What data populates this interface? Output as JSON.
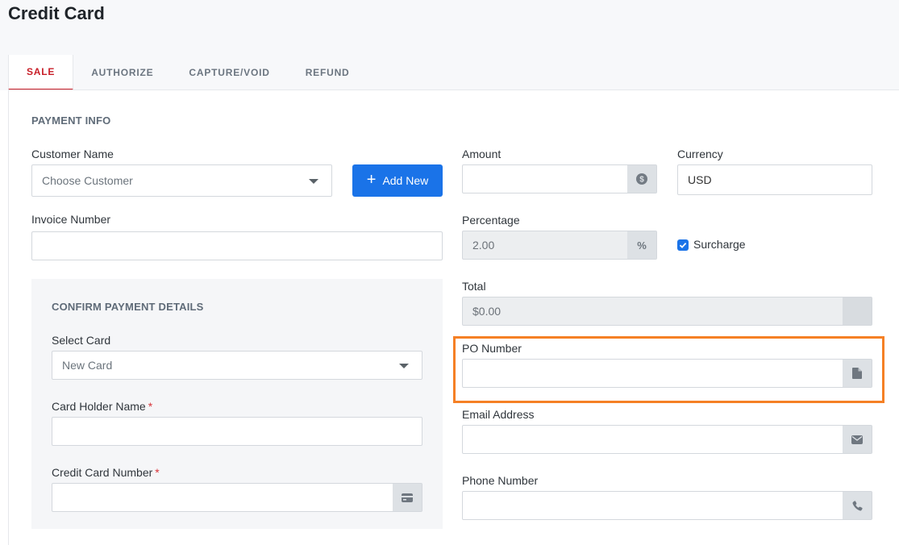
{
  "page": {
    "title": "Credit Card"
  },
  "tabs": [
    {
      "label": "SALE",
      "active": true
    },
    {
      "label": "AUTHORIZE",
      "active": false
    },
    {
      "label": "CAPTURE/VOID",
      "active": false
    },
    {
      "label": "REFUND",
      "active": false
    }
  ],
  "payment_info": {
    "title": "PAYMENT INFO",
    "customer_name": {
      "label": "Customer Name",
      "placeholder": "Choose Customer"
    },
    "add_new_label": "Add New",
    "invoice_number": {
      "label": "Invoice Number",
      "value": ""
    },
    "amount": {
      "label": "Amount",
      "value": "",
      "icon": "dollar-icon"
    },
    "currency": {
      "label": "Currency",
      "value": "USD"
    },
    "percentage": {
      "label": "Percentage",
      "value": "2.00",
      "addon": "%"
    },
    "surcharge": {
      "label": "Surcharge",
      "checked": true
    },
    "total": {
      "label": "Total",
      "value": "$0.00"
    },
    "po_number": {
      "label": "PO Number",
      "value": "",
      "icon": "document-icon"
    },
    "email": {
      "label": "Email Address",
      "value": "",
      "icon": "envelope-icon"
    },
    "phone": {
      "label": "Phone Number",
      "value": "",
      "icon": "phone-icon"
    }
  },
  "confirm_payment": {
    "title": "CONFIRM PAYMENT DETAILS",
    "select_card": {
      "label": "Select Card",
      "value": "New Card"
    },
    "card_holder": {
      "label": "Card Holder Name",
      "required_mark": "*"
    },
    "card_number": {
      "label": "Credit Card Number",
      "required_mark": "*",
      "icon": "credit-card-icon"
    }
  },
  "colors": {
    "accent": "#1a73e8",
    "active_tab": "#c81e28",
    "highlight": "#f58025"
  }
}
